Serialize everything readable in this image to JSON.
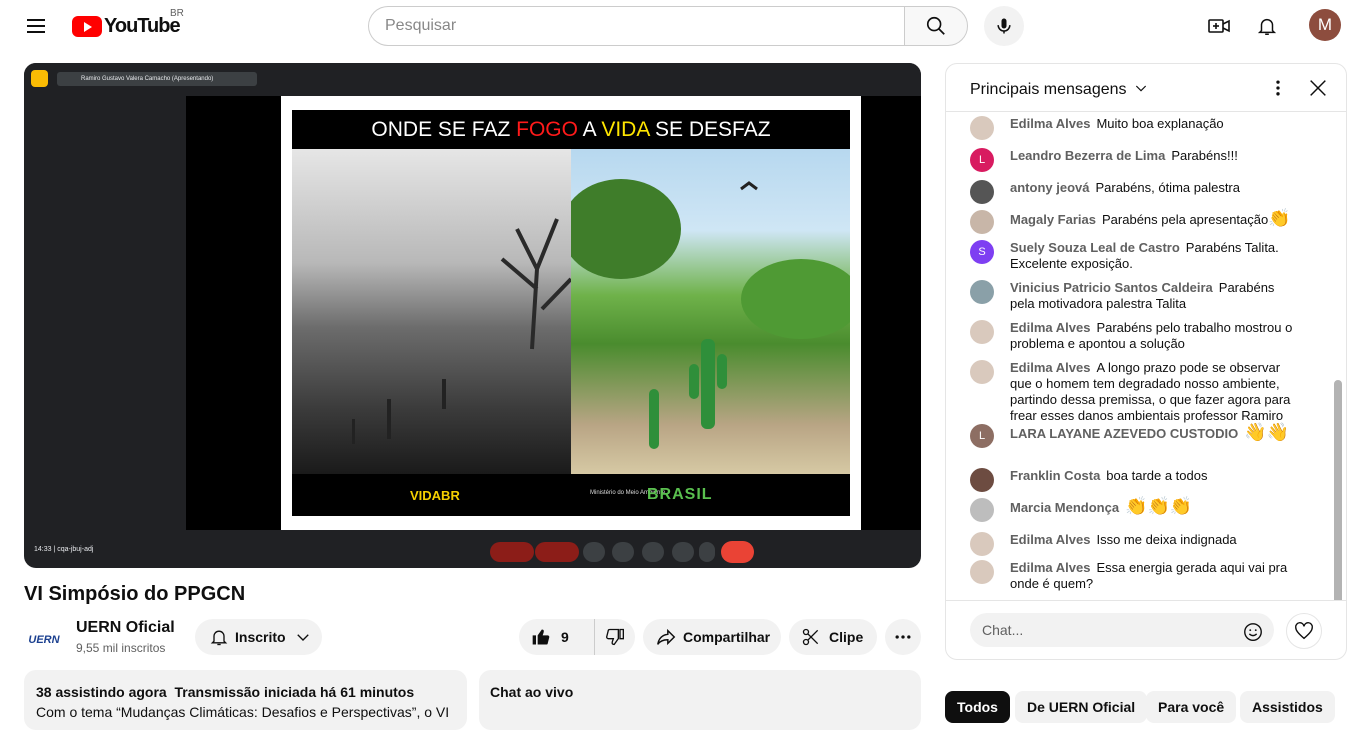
{
  "header": {
    "logo_text": "YouTube",
    "region": "BR",
    "search_placeholder": "Pesquisar",
    "avatar_letter": "M",
    "avatar_color": "#8d4d3e"
  },
  "player": {
    "presenter": "Ramiro Gustavo Valera Camacho (Apresentando)",
    "slide_title_1": "ONDE SE FAZ ",
    "slide_title_fire": "FOGO",
    "slide_title_2": " A ",
    "slide_title_life": "VIDA",
    "slide_title_3": " SE DESFAZ",
    "logo_vida": "VIDABR",
    "logo_ministerio": "Ministério do Meio Ambiente",
    "logo_brasil": "BRASIL",
    "meet_time": "14:33 | cqa-jbuj-adj"
  },
  "video": {
    "title": "VI Simpósio do PPGCN",
    "channel_logo": "UERN",
    "channel_name": "UERN Oficial",
    "subscribers": "9,55 mil inscritos",
    "subscribe_label": "Inscrito",
    "likes": "9",
    "share_label": "Compartilhar",
    "clip_label": "Clipe"
  },
  "description": {
    "watching": "38 assistindo agora",
    "started": "Transmissão iniciada há 61 minutos",
    "text": "Com o tema “Mudanças Climáticas: Desafios e Perspectivas”, o VI"
  },
  "chat_collapsed_label": "Chat ao vivo",
  "chat": {
    "title": "Principais mensagens",
    "input_placeholder": "Chat...",
    "messages": [
      {
        "author": "Edilma Alves",
        "text": "Muito boa explanação",
        "avatar_letter": "",
        "avatar_color": "#d9c9bd",
        "emoji": ""
      },
      {
        "author": "Leandro Bezerra de Lima",
        "text": "Parabéns!!!",
        "avatar_letter": "L",
        "avatar_color": "#d81b60",
        "emoji": ""
      },
      {
        "author": "antony jeová",
        "text": "Parabéns, ótima palestra",
        "avatar_letter": "",
        "avatar_color": "#555555",
        "emoji": ""
      },
      {
        "author": "Magaly Farias",
        "text": "Parabéns pela apresentação",
        "avatar_letter": "",
        "avatar_color": "#c8b6a8",
        "emoji": "👏"
      },
      {
        "author": "Suely Souza Leal de Castro",
        "text": "Parabéns Talita. Excelente exposição.",
        "avatar_letter": "S",
        "avatar_color": "#7e3ff2",
        "emoji": ""
      },
      {
        "author": "Vinicius Patricio Santos Caldeira",
        "text": "Parabéns pela motivadora palestra Talita",
        "avatar_letter": "",
        "avatar_color": "#8aa0a8",
        "emoji": ""
      },
      {
        "author": "Edilma Alves",
        "text": "Parabéns pelo trabalho mostrou o problema e apontou a solução",
        "avatar_letter": "",
        "avatar_color": "#d9c9bd",
        "emoji": ""
      },
      {
        "author": "Edilma Alves",
        "text": "A longo prazo pode se observar que o homem tem degradado nosso ambiente, partindo dessa premissa, o que fazer agora para frear esses danos ambientais professor Ramiro",
        "avatar_letter": "",
        "avatar_color": "#d9c9bd",
        "emoji": ""
      },
      {
        "author": "LARA LAYANE AZEVEDO CUSTODIO",
        "text": "",
        "avatar_letter": "L",
        "avatar_color": "#8d6e63",
        "emoji": "👋👋"
      },
      {
        "author": "Franklin Costa",
        "text": "boa tarde a todos",
        "avatar_letter": "",
        "avatar_color": "#6d4c41",
        "emoji": ""
      },
      {
        "author": "Marcia Mendonça",
        "text": "",
        "avatar_letter": "",
        "avatar_color": "#bdbdbd",
        "emoji": "👏👏👏"
      },
      {
        "author": "Edilma Alves",
        "text": "Isso me deixa indignada",
        "avatar_letter": "",
        "avatar_color": "#d9c9bd",
        "emoji": ""
      },
      {
        "author": "Edilma Alves",
        "text": "Essa energia gerada aqui vai pra onde é quem?",
        "avatar_letter": "",
        "avatar_color": "#d9c9bd",
        "emoji": ""
      }
    ]
  },
  "chips": [
    "Todos",
    "De UERN Oficial",
    "Para você",
    "Assistidos"
  ]
}
